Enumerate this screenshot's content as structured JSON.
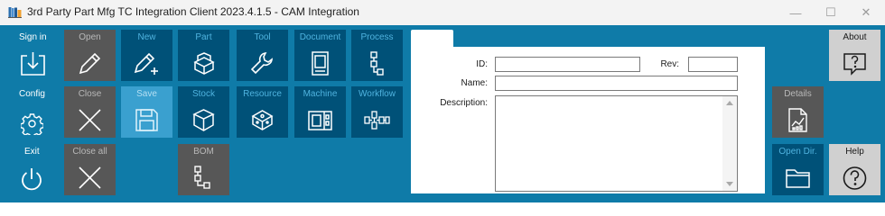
{
  "window": {
    "title": "3rd Party Part Mfg TC Integration Client 2023.4.1.5 - CAM Integration",
    "app_icon": "app-books-icon",
    "min_glyph": "—",
    "max_glyph": "☐",
    "close_glyph": "✕"
  },
  "sidebar": {
    "sign_in": "Sign in",
    "config": "Config",
    "exit": "Exit"
  },
  "tiles": {
    "open": "Open",
    "new": "New",
    "part": "Part",
    "tool": "Tool",
    "document": "Document",
    "process": "Process",
    "close": "Close",
    "save": "Save",
    "stock": "Stock",
    "resource": "Resource",
    "machine": "Machine",
    "workflow": "Workflow",
    "close_all": "Close all",
    "bom": "BOM"
  },
  "form": {
    "tab_label": "",
    "id_label": "ID:",
    "id_value": "",
    "rev_label": "Rev:",
    "rev_value": "",
    "name_label": "Name:",
    "name_value": "",
    "description_label": "Description:",
    "description_value": ""
  },
  "right": {
    "about": "About",
    "details": "Details",
    "open_dir": "Open Dir.",
    "help": "Help"
  },
  "colors": {
    "toolbar_bg": "#0f7ba8",
    "tile_dark": "#005178",
    "tile_gray": "#575757",
    "tile_selected": "#3aa0cf",
    "tile_light": "#d0d0d0"
  }
}
